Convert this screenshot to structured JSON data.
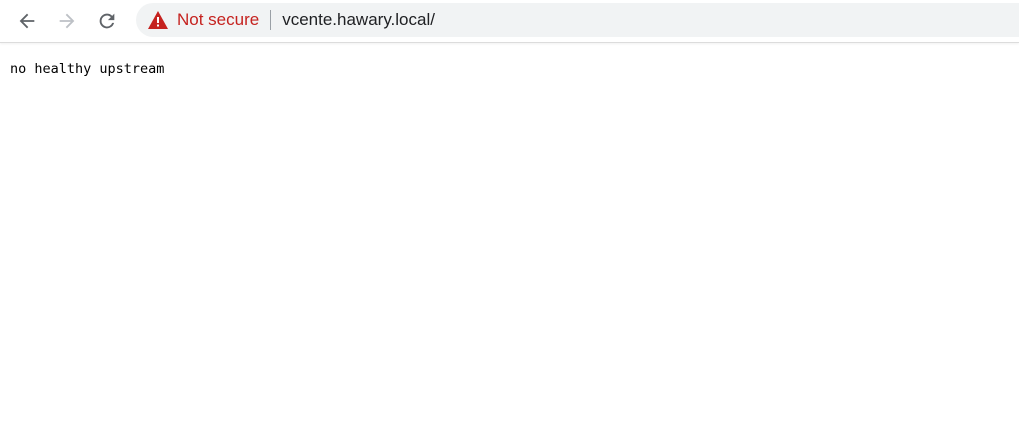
{
  "browser": {
    "security_label": "Not secure",
    "url": "vcente.hawary.local/",
    "warning_color": "#c5221f"
  },
  "page": {
    "body_text": "no healthy upstream"
  }
}
